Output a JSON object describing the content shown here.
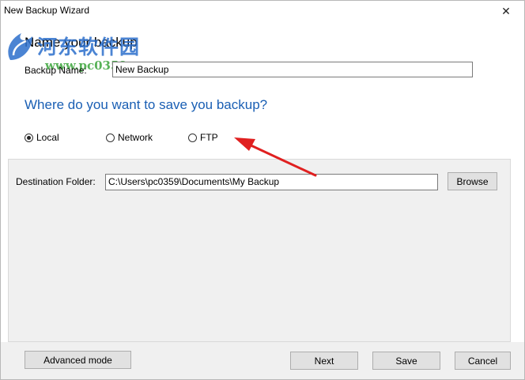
{
  "window": {
    "title": "New Backup Wizard",
    "close_glyph": "✕"
  },
  "watermark": {
    "brand": "河东软件园",
    "url": "www.pc0359.cn"
  },
  "step": {
    "title": "Name your backup"
  },
  "backup_name": {
    "label": "Backup Name:",
    "value": "New Backup"
  },
  "destination": {
    "question": "Where do you want to save you backup?",
    "options": [
      {
        "label": "Local",
        "selected": true
      },
      {
        "label": "Network",
        "selected": false
      },
      {
        "label": "FTP",
        "selected": false
      }
    ]
  },
  "folder": {
    "label": "Destination Folder:",
    "value": "C:\\Users\\pc0359\\Documents\\My Backup",
    "browse_label": "Browse"
  },
  "footer": {
    "advanced_label": "Advanced mode",
    "next_label": "Next",
    "save_label": "Save",
    "cancel_label": "Cancel"
  },
  "colors": {
    "accent": "#1a5fb4",
    "arrow": "#e02020"
  }
}
